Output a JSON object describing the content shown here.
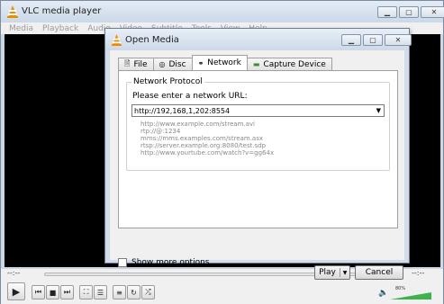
{
  "main_window": {
    "title": "VLC media player",
    "menu": [
      "Media",
      "Playback",
      "Audio",
      "Video",
      "Subtitle",
      "Tools",
      "View",
      "Help"
    ],
    "elapsed": "--:--",
    "remaining": "--:--",
    "volume_percent": "80%",
    "volume_level": 0.8
  },
  "dialog": {
    "title": "Open Media",
    "tabs": [
      {
        "label": "File",
        "icon": "file-icon"
      },
      {
        "label": "Disc",
        "icon": "disc-icon"
      },
      {
        "label": "Network",
        "icon": "network-icon"
      },
      {
        "label": "Capture Device",
        "icon": "capture-device-icon"
      }
    ],
    "active_tab": "Network",
    "group_title": "Network Protocol",
    "prompt": "Please enter a network URL:",
    "url_value": "http://192,168,1,202:8554",
    "examples": [
      "http://www.example.com/stream.avi",
      "rtp://@:1234",
      "mms://mms.examples.com/stream.asx",
      "rtsp://server.example.org:8080/test.sdp",
      "http://www.yourtube.com/watch?v=gg64x"
    ],
    "show_more_label": "Show more options",
    "show_more_checked": false,
    "play_label": "Play",
    "cancel_label": "Cancel"
  },
  "colors": {
    "title_bar": "#cbd8e8",
    "video_bg": "#000000",
    "volume": "#3cb44b",
    "vlc_orange": "#f08a00"
  }
}
